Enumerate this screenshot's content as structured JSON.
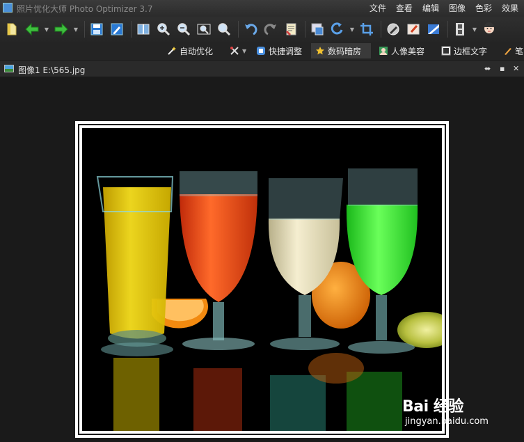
{
  "app": {
    "title": "照片优化大师 Photo Optimizer 3.7"
  },
  "menu": [
    "文件",
    "查看",
    "编辑",
    "图像",
    "色彩",
    "效果"
  ],
  "toolbar": {
    "buttons": [
      {
        "name": "open-icon"
      },
      {
        "name": "back-arrow-icon",
        "dropdown": true
      },
      {
        "name": "forward-arrow-icon",
        "dropdown": true
      },
      {
        "name": "save-icon"
      },
      {
        "name": "save-as-icon"
      },
      {
        "name": "compare-view-icon"
      },
      {
        "name": "zoom-in-icon"
      },
      {
        "name": "zoom-out-icon"
      },
      {
        "name": "fit-window-icon"
      },
      {
        "name": "actual-size-icon"
      },
      {
        "name": "undo-icon"
      },
      {
        "name": "redo-icon"
      },
      {
        "name": "history-icon"
      },
      {
        "name": "resize-icon"
      },
      {
        "name": "rotate-icon",
        "dropdown": true
      },
      {
        "name": "crop-icon"
      },
      {
        "name": "color-picker-icon"
      },
      {
        "name": "brush-icon"
      },
      {
        "name": "gradient-icon"
      },
      {
        "name": "filmstrip-icon",
        "dropdown": true
      },
      {
        "name": "face-icon"
      }
    ]
  },
  "tabs": [
    {
      "label": "自动优化",
      "icon": "magic-wand-icon",
      "active": false
    },
    {
      "label": "",
      "icon": "tools-icon",
      "active": false,
      "dropdown": true
    },
    {
      "label": "快捷调整",
      "icon": "quick-adjust-icon",
      "active": false
    },
    {
      "label": "数码暗房",
      "icon": "star-icon",
      "active": true
    },
    {
      "label": "人像美容",
      "icon": "portrait-icon",
      "active": false
    },
    {
      "label": "边框文字",
      "icon": "frame-text-icon",
      "active": false
    },
    {
      "label": "笔",
      "icon": "brush-icon",
      "active": false
    }
  ],
  "document": {
    "title": "图像1 E:\\565.jpg"
  },
  "watermark": {
    "main": "Bai 经验",
    "sub": "jingyan.baidu.com"
  },
  "colors": {
    "juice_yellow": "#f2d40a",
    "juice_red": "#f04a18",
    "juice_cream": "#efe6c0",
    "juice_green": "#3ee83a",
    "orange": "#f28a10"
  }
}
